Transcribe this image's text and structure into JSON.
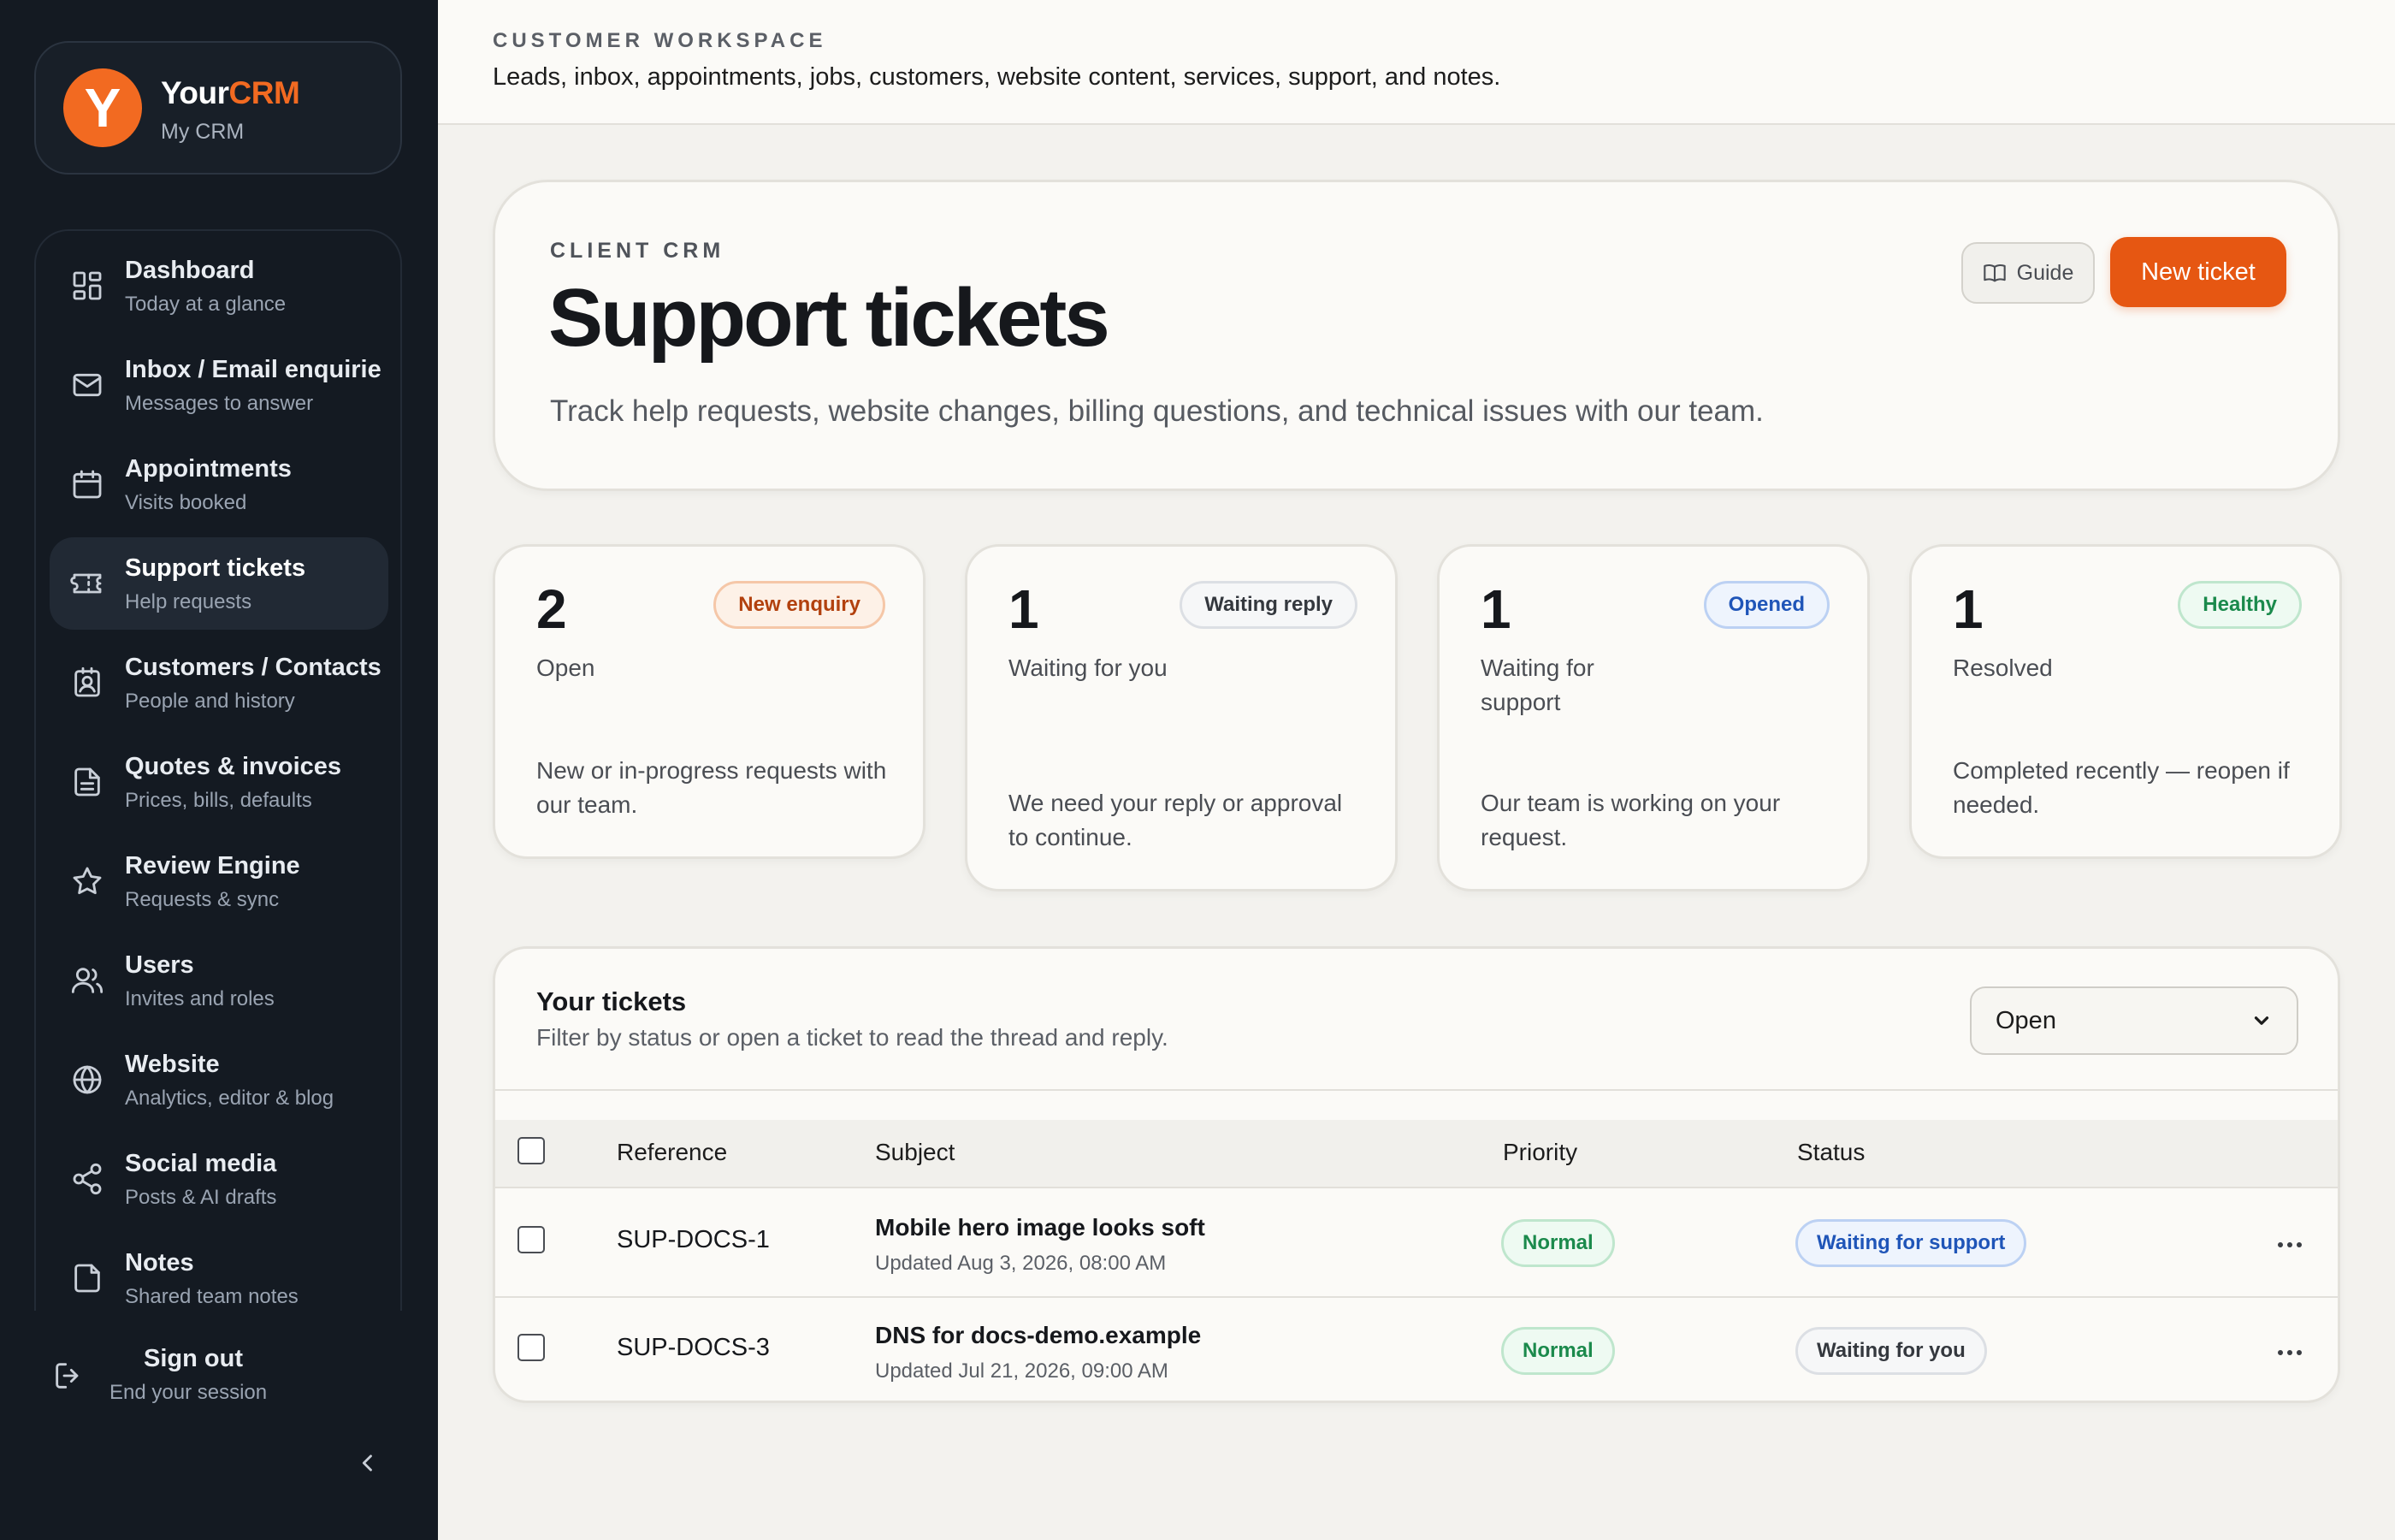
{
  "brand": {
    "logo_letter": "Y",
    "name_part1": "Your",
    "name_part2": "CRM",
    "subtitle": "My CRM",
    "accent_color": "#f26a21"
  },
  "sidebar": {
    "items": [
      {
        "label": "Dashboard",
        "sub": "Today at a glance",
        "icon": "dashboard-icon"
      },
      {
        "label": "Inbox / Email enquiries",
        "sub": "Messages to answer",
        "icon": "mail-icon"
      },
      {
        "label": "Appointments",
        "sub": "Visits booked",
        "icon": "calendar-icon"
      },
      {
        "label": "Support tickets",
        "sub": "Help requests",
        "icon": "ticket-icon",
        "active": true
      },
      {
        "label": "Customers / Contacts",
        "sub": "People and history",
        "icon": "contact-icon"
      },
      {
        "label": "Quotes & invoices",
        "sub": "Prices, bills, defaults",
        "icon": "document-icon"
      },
      {
        "label": "Review Engine",
        "sub": "Requests & sync",
        "icon": "star-icon"
      },
      {
        "label": "Users",
        "sub": "Invites and roles",
        "icon": "users-icon"
      },
      {
        "label": "Website",
        "sub": "Analytics, editor & blog",
        "icon": "globe-icon"
      },
      {
        "label": "Social media",
        "sub": "Posts & AI drafts",
        "icon": "share-icon"
      },
      {
        "label": "Notes",
        "sub": "Shared team notes",
        "icon": "note-icon"
      }
    ],
    "signout": {
      "label": "Sign out",
      "sub": "End your session"
    }
  },
  "header": {
    "eyebrow": "CUSTOMER WORKSPACE",
    "description": "Leads, inbox, appointments, jobs, customers, website content, services, support, and notes."
  },
  "hero": {
    "eyebrow": "CLIENT CRM",
    "title": "Support tickets",
    "description": "Track help requests, website changes, billing questions, and technical issues with our team.",
    "guide_label": "Guide",
    "new_ticket_label": "New ticket"
  },
  "stats": [
    {
      "count": "1",
      "label": "Waiting for you",
      "badge": "Waiting reply",
      "description": "We need your reply or approval to continue."
    },
    {
      "count": "2",
      "label": "Open",
      "badge": "New enquiry",
      "description": "New or in-progress requests with our team."
    },
    {
      "count": "1",
      "label": "Waiting for support",
      "badge": "Opened",
      "description": "Our team is working on your request."
    },
    {
      "count": "1",
      "label": "Resolved",
      "badge": "Healthy",
      "description": "Completed recently — reopen if needed."
    }
  ],
  "tickets_panel": {
    "title": "Your tickets",
    "description": "Filter by status or open a ticket to read the thread and reply.",
    "filter_value": "Open",
    "columns": {
      "reference": "Reference",
      "subject": "Subject",
      "priority": "Priority",
      "status": "Status"
    },
    "rows": [
      {
        "reference": "SUP-DOCS-1",
        "subject": "Mobile hero image looks soft",
        "updated": "Updated Aug 3, 2026, 08:00 AM",
        "priority": "Normal",
        "status": "Waiting for support"
      },
      {
        "reference": "SUP-DOCS-3",
        "subject": "DNS for docs-demo.example",
        "updated": "Updated Jul 21, 2026, 09:00 AM",
        "priority": "Normal",
        "status": "Waiting for you"
      }
    ]
  }
}
